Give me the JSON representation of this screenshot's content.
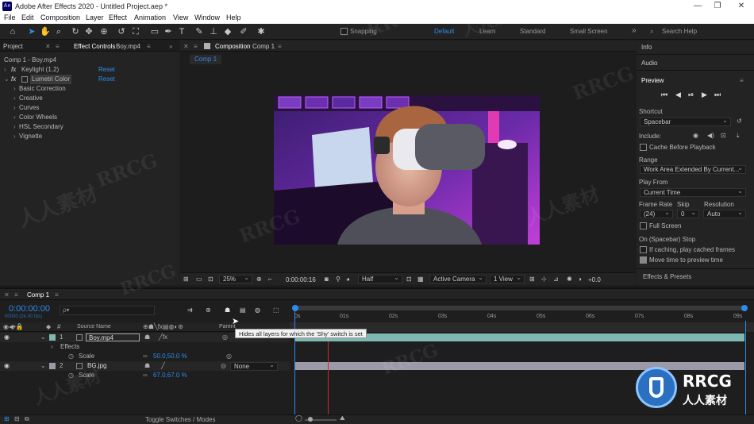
{
  "window": {
    "title": "Adobe After Effects 2020 - Untitled Project.aep *",
    "logo_text": "Ae",
    "minimize": "—",
    "restore": "❐",
    "close": "✕"
  },
  "menu": [
    "File",
    "Edit",
    "Composition",
    "Layer",
    "Effect",
    "Animation",
    "View",
    "Window",
    "Help"
  ],
  "toolbar": {
    "snapping_label": "Snapping",
    "workspaces": [
      "Default",
      "Learn",
      "Standard",
      "Small Screen"
    ],
    "active_workspace": "Default",
    "more": "»",
    "search_placeholder": "Search Help"
  },
  "left_panel": {
    "tabs": [
      "Project",
      "Effect Controls"
    ],
    "effect_target": "Boy.mp4",
    "breadcrumb": "Comp 1 - Boy.mp4",
    "effects": [
      {
        "name": "Keylight (1.2)",
        "reset": "Reset"
      },
      {
        "name": "Lumetri Color",
        "reset": "Reset"
      }
    ],
    "lumetri_groups": [
      "Basic Correction",
      "Creative",
      "Curves",
      "Color Wheels",
      "HSL Secondary",
      "Vignette"
    ]
  },
  "composition": {
    "tab_prefix": "Composition",
    "tab_name": "Comp 1",
    "sub_tab": "Comp 1",
    "zoom": "25%",
    "timecode": "0:00:00:16",
    "resolution": "Half",
    "camera": "Active Camera",
    "views": "1 View",
    "exposure": "+0.0"
  },
  "right_panel": {
    "info": "Info",
    "audio": "Audio",
    "preview": "Preview",
    "preview_controls": [
      "⏮",
      "◀",
      "⏯",
      "▶",
      "⏭"
    ],
    "shortcut_label": "Shortcut",
    "shortcut_value": "Spacebar",
    "include_label": "Include:",
    "cache_before_playback": "Cache Before Playback",
    "range_label": "Range",
    "range_value": "Work Area Extended By Current...",
    "play_from_label": "Play From",
    "play_from_value": "Current Time",
    "frame_rate_label": "Frame Rate",
    "skip_label": "Skip",
    "resolution_label": "Resolution",
    "frame_rate_value": "(24)",
    "skip_value": "0",
    "resolution_value": "Auto",
    "full_screen": "Full Screen",
    "on_stop_label": "On (Spacebar) Stop",
    "if_caching": "If caching, play cached frames",
    "move_time": "Move time to preview time",
    "effects_presets": "Effects & Presets"
  },
  "timeline": {
    "tab": "Comp 1",
    "timecode": "0:00:00:00",
    "fps_hint": "00000 (24.00 fps)",
    "search_placeholder": "ρ▾",
    "header_source_name": "Source Name",
    "header_parent": "Parent",
    "layers": [
      {
        "num": "1",
        "name": "Boy.mp4",
        "color": "#7fb8b2"
      },
      {
        "num": "2",
        "name": "BG.jpg",
        "color": "#9a9aa8",
        "parent": "None"
      }
    ],
    "effects_label": "Effects",
    "scale_label": "Scale",
    "scale_1": "50.0,50.0 %",
    "scale_2": "67.0,67.0 %",
    "ticks": [
      "0s",
      "01s",
      "02s",
      "03s",
      "04s",
      "05s",
      "06s",
      "07s",
      "08s",
      "09s"
    ],
    "tooltip": "Hides all layers for which the 'Shy' switch is set",
    "toggle_label": "Toggle Switches / Modes"
  },
  "watermarks": [
    "RRCG",
    "人人素材"
  ],
  "brand": {
    "logo_text": "RRCG",
    "sub": "人人素材"
  },
  "colors": {
    "accent": "#2d8ceb",
    "layer1": "#7fb8b2",
    "layer2": "#9a9aa8",
    "playhead": "#cc2b2b"
  }
}
